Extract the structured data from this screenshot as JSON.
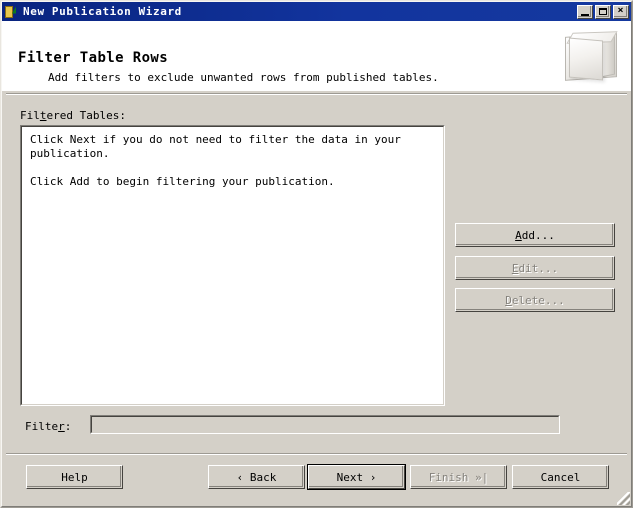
{
  "window": {
    "title": "New Publication Wizard",
    "icon": "publication-wizard-icon",
    "minimize_label": "",
    "maximize_label": "",
    "close_label": "×",
    "background_color": "#d4d0c8",
    "titlebar_color": "#0a2a8c"
  },
  "header": {
    "title": "Filter Table Rows",
    "subtitle": "Add filters to exclude unwanted rows from published tables.",
    "art_icon": "publication-book-icon"
  },
  "body": {
    "filtered_tables_label_pre": "Fil",
    "filtered_tables_label_accel": "t",
    "filtered_tables_label_post": "ered Tables:",
    "list_text": "Click Next if you do not need to filter the data in your\npublication.\n\nClick Add to begin filtering your publication.",
    "filter_label_pre": "Filte",
    "filter_label_accel": "r",
    "filter_label_post": ":",
    "filter_value": "",
    "filter_placeholder": ""
  },
  "side_buttons": [
    {
      "name": "add-button",
      "pre": "",
      "accel": "A",
      "post": "dd...",
      "enabled": true
    },
    {
      "name": "edit-button",
      "pre": "",
      "accel": "E",
      "post": "dit...",
      "enabled": false
    },
    {
      "name": "delete-button",
      "pre": "",
      "accel": "D",
      "post": "elete...",
      "enabled": false
    }
  ],
  "nav_buttons": {
    "help": "Help",
    "back": "‹ Back",
    "next": "Next ›",
    "finish": "Finish »|",
    "cancel": "Cancel",
    "default_button": "next",
    "disabled": [
      "finish"
    ]
  },
  "labels": {
    "add": "Add...",
    "edit": "Edit...",
    "delete": "Delete..."
  }
}
